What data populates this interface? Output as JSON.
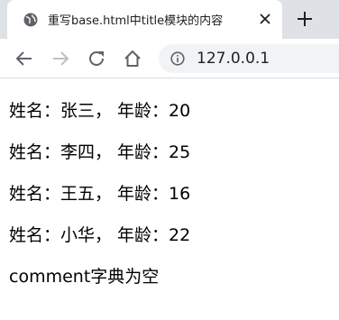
{
  "tab": {
    "title": "重写base.html中title模块的内容",
    "favicon_icon": "globe-icon",
    "close_icon": "close-icon"
  },
  "new_tab_icon": "plus-icon",
  "toolbar": {
    "back_icon": "back-arrow-icon",
    "forward_icon": "forward-arrow-icon",
    "reload_icon": "reload-icon",
    "home_icon": "home-icon",
    "site_info_icon": "info-icon",
    "url": "127.0.0.1"
  },
  "page": {
    "rows": [
      "姓名：张三， 年龄：20",
      "姓名：李四， 年龄：25",
      "姓名：王五， 年龄：16",
      "姓名：小华， 年龄：22"
    ],
    "comment_text": "comment字典为空"
  },
  "colors": {
    "tabstrip_bg": "#dee1e6",
    "omnibox_bg": "#f1f3f4",
    "icon": "#5f6368",
    "disabled_icon": "#bdc1c6"
  }
}
